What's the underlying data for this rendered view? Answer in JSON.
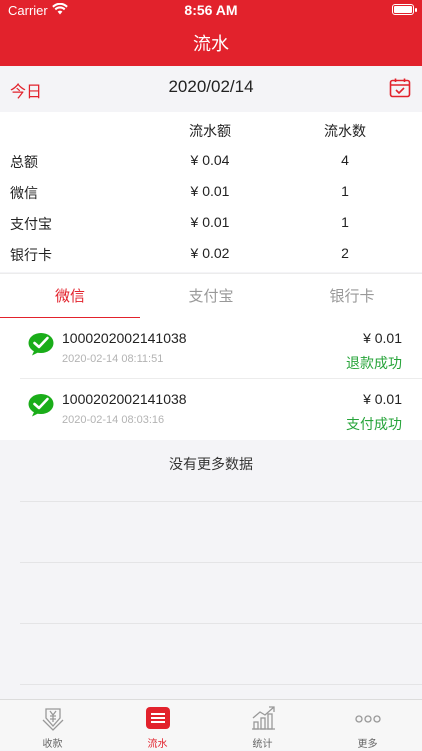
{
  "status_bar": {
    "carrier": "Carrier",
    "time": "8:56 AM"
  },
  "header": {
    "title": "流水"
  },
  "date_bar": {
    "today_label": "今日",
    "date": "2020/02/14",
    "calendar_icon": "calendar-check-icon"
  },
  "summary": {
    "col_amount": "流水额",
    "col_count": "流水数",
    "rows": [
      {
        "label": "总额",
        "amount": "¥ 0.04",
        "count": "4"
      },
      {
        "label": "微信",
        "amount": "¥ 0.01",
        "count": "1"
      },
      {
        "label": "支付宝",
        "amount": "¥ 0.01",
        "count": "1"
      },
      {
        "label": "银行卡",
        "amount": "¥ 0.02",
        "count": "2"
      }
    ]
  },
  "tabs": [
    {
      "label": "微信",
      "active": true
    },
    {
      "label": "支付宝",
      "active": false
    },
    {
      "label": "银行卡",
      "active": false
    }
  ],
  "transactions": [
    {
      "id": "1000202002141038",
      "time": "2020-02-14 08:11:51",
      "amount": "¥ 0.01",
      "status": "退款成功",
      "icon": "wechat-pay-icon"
    },
    {
      "id": "1000202002141038",
      "time": "2020-02-14 08:03:16",
      "amount": "¥ 0.01",
      "status": "支付成功",
      "icon": "wechat-pay-icon"
    }
  ],
  "no_more": "没有更多数据",
  "tabbar": [
    {
      "label": "收款",
      "icon": "yuan-receive-icon",
      "active": false
    },
    {
      "label": "流水",
      "icon": "list-icon",
      "active": true
    },
    {
      "label": "统计",
      "icon": "chart-growth-icon",
      "active": false
    },
    {
      "label": "更多",
      "icon": "more-dots-icon",
      "active": false
    }
  ],
  "colors": {
    "brand_red": "#e2222c",
    "success_green": "#27a43a",
    "wechat_green": "#1aad19"
  }
}
